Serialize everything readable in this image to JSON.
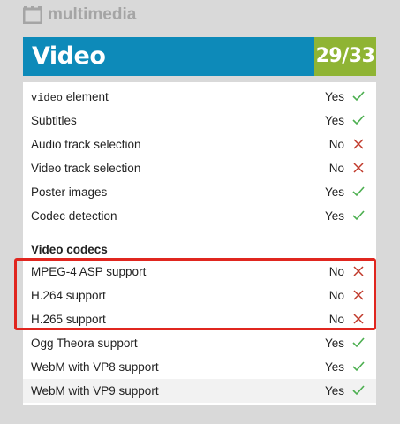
{
  "header": {
    "section_name": "multimedia",
    "icon": "film-frame-icon"
  },
  "banner": {
    "title": "Video",
    "score": "29/33",
    "colors": {
      "title_bg": "#0d8ab9",
      "score_bg": "#8fb434"
    }
  },
  "features": [
    {
      "code": "video",
      "label": " element",
      "result": "Yes",
      "status": "pass"
    },
    {
      "label": "Subtitles",
      "result": "Yes",
      "status": "pass"
    },
    {
      "label": "Audio track selection",
      "result": "No",
      "status": "fail"
    },
    {
      "label": "Video track selection",
      "result": "No",
      "status": "fail"
    },
    {
      "label": "Poster images",
      "result": "Yes",
      "status": "pass"
    },
    {
      "label": "Codec detection",
      "result": "Yes",
      "status": "pass"
    }
  ],
  "codecs": {
    "title": "Video codecs",
    "items": [
      {
        "label": "MPEG-4 ASP support",
        "result": "No",
        "status": "fail"
      },
      {
        "label": "H.264 support",
        "result": "No",
        "status": "fail"
      },
      {
        "label": "H.265 support",
        "result": "No",
        "status": "fail"
      },
      {
        "label": "Ogg Theora support",
        "result": "Yes",
        "status": "pass"
      },
      {
        "label": "WebM with VP8 support",
        "result": "Yes",
        "status": "pass"
      },
      {
        "label": "WebM with VP9 support",
        "result": "Yes",
        "status": "pass"
      }
    ]
  },
  "status_colors": {
    "pass": "#4caf50",
    "fail": "#c0392b"
  }
}
